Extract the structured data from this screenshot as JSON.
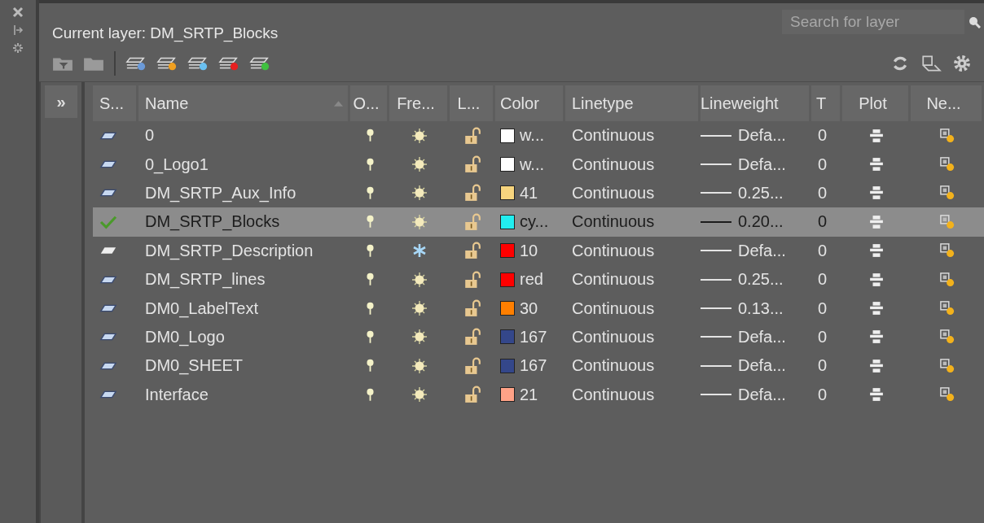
{
  "panel": {
    "current_layer": "Current layer: DM_SRTP_Blocks",
    "search": {
      "placeholder": "Search for layer"
    },
    "filter_toggle": "»"
  },
  "columns": [
    {
      "label": "S...",
      "sorted": false
    },
    {
      "label": "Name",
      "sorted": true
    },
    {
      "label": "O...",
      "sorted": false
    },
    {
      "label": "Fre...",
      "sorted": false
    },
    {
      "label": "L...",
      "sorted": false
    },
    {
      "label": "Color",
      "sorted": false
    },
    {
      "label": "Linetype",
      "sorted": false
    },
    {
      "label": "Lineweight",
      "sorted": false
    },
    {
      "label": "T",
      "sorted": false
    },
    {
      "label": "Plot",
      "sorted": false
    },
    {
      "label": "Ne...",
      "sorted": false
    }
  ],
  "rows": [
    {
      "kind": "in_use",
      "name": "0",
      "on": true,
      "frozen": false,
      "locked": false,
      "color": "#ffffff",
      "color_label": "w...",
      "linetype": "Continuous",
      "lineweight": "Defa...",
      "transparency": "0",
      "plot": true,
      "selected": false
    },
    {
      "kind": "in_use",
      "name": "0_Logo1",
      "on": true,
      "frozen": false,
      "locked": false,
      "color": "#ffffff",
      "color_label": "w...",
      "linetype": "Continuous",
      "lineweight": "Defa...",
      "transparency": "0",
      "plot": true,
      "selected": false
    },
    {
      "kind": "in_use",
      "name": "DM_SRTP_Aux_Info",
      "on": true,
      "frozen": false,
      "locked": false,
      "color": "#f7d57e",
      "color_label": "41",
      "linetype": "Continuous",
      "lineweight": "0.25...",
      "transparency": "0",
      "plot": true,
      "selected": false
    },
    {
      "kind": "current",
      "name": "DM_SRTP_Blocks",
      "on": true,
      "frozen": false,
      "locked": false,
      "color": "#22eef0",
      "color_label": "cy...",
      "linetype": "Continuous",
      "lineweight": "0.20...",
      "transparency": "0",
      "plot": true,
      "selected": true
    },
    {
      "kind": "unused",
      "name": "DM_SRTP_Description",
      "on": true,
      "frozen": true,
      "locked": false,
      "color": "#ff0000",
      "color_label": "10",
      "linetype": "Continuous",
      "lineweight": "Defa...",
      "transparency": "0",
      "plot": true,
      "selected": false
    },
    {
      "kind": "in_use",
      "name": "DM_SRTP_lines",
      "on": true,
      "frozen": false,
      "locked": false,
      "color": "#ff0000",
      "color_label": "red",
      "linetype": "Continuous",
      "lineweight": "0.25...",
      "transparency": "0",
      "plot": true,
      "selected": false
    },
    {
      "kind": "in_use",
      "name": "DM0_LabelText",
      "on": true,
      "frozen": false,
      "locked": false,
      "color": "#ff7f00",
      "color_label": "30",
      "linetype": "Continuous",
      "lineweight": "0.13...",
      "transparency": "0",
      "plot": true,
      "selected": false
    },
    {
      "kind": "in_use",
      "name": "DM0_Logo",
      "on": true,
      "frozen": false,
      "locked": false,
      "color": "#34478a",
      "color_label": "167",
      "linetype": "Continuous",
      "lineweight": "Defa...",
      "transparency": "0",
      "plot": true,
      "selected": false
    },
    {
      "kind": "in_use",
      "name": "DM0_SHEET",
      "on": true,
      "frozen": false,
      "locked": false,
      "color": "#34478a",
      "color_label": "167",
      "linetype": "Continuous",
      "lineweight": "Defa...",
      "transparency": "0",
      "plot": true,
      "selected": false
    },
    {
      "kind": "in_use",
      "name": "Interface",
      "on": true,
      "frozen": false,
      "locked": false,
      "color": "#ffa287",
      "color_label": "21",
      "linetype": "Continuous",
      "lineweight": "Defa...",
      "transparency": "0",
      "plot": true,
      "selected": false
    }
  ]
}
